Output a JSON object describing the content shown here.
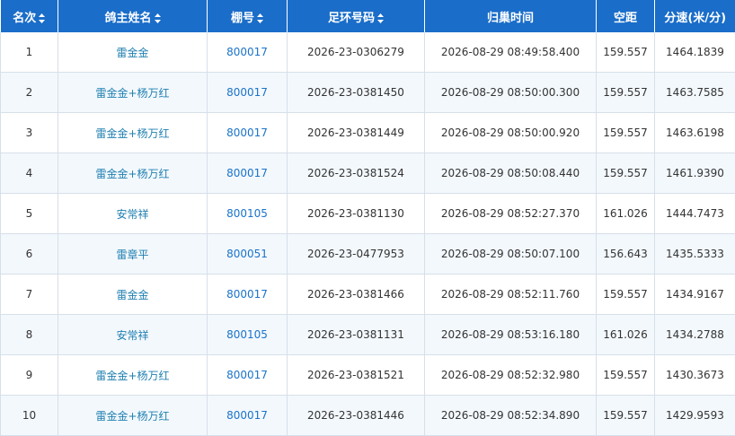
{
  "table": {
    "headers": [
      {
        "key": "rank",
        "label": "名次",
        "sortable": true
      },
      {
        "key": "owner",
        "label": "鸽主姓名",
        "sortable": true
      },
      {
        "key": "loft",
        "label": "棚号",
        "sortable": true
      },
      {
        "key": "ring",
        "label": "足环号码",
        "sortable": true
      },
      {
        "key": "arrival",
        "label": "归巢时间",
        "sortable": false
      },
      {
        "key": "distance",
        "label": "空距",
        "sortable": false
      },
      {
        "key": "speed",
        "label": "分速(米/分)",
        "sortable": false
      }
    ],
    "rows": [
      {
        "rank": "1",
        "owner": "雷金金",
        "loft": "800017",
        "ring": "2026-23-0306279",
        "arrival": "2026-08-29 08:49:58.400",
        "distance": "159.557",
        "speed": "1464.1839"
      },
      {
        "rank": "2",
        "owner": "雷金金+杨万红",
        "loft": "800017",
        "ring": "2026-23-0381450",
        "arrival": "2026-08-29 08:50:00.300",
        "distance": "159.557",
        "speed": "1463.7585"
      },
      {
        "rank": "3",
        "owner": "雷金金+杨万红",
        "loft": "800017",
        "ring": "2026-23-0381449",
        "arrival": "2026-08-29 08:50:00.920",
        "distance": "159.557",
        "speed": "1463.6198"
      },
      {
        "rank": "4",
        "owner": "雷金金+杨万红",
        "loft": "800017",
        "ring": "2026-23-0381524",
        "arrival": "2026-08-29 08:50:08.440",
        "distance": "159.557",
        "speed": "1461.9390"
      },
      {
        "rank": "5",
        "owner": "安常祥",
        "loft": "800105",
        "ring": "2026-23-0381130",
        "arrival": "2026-08-29 08:52:27.370",
        "distance": "161.026",
        "speed": "1444.7473"
      },
      {
        "rank": "6",
        "owner": "雷章平",
        "loft": "800051",
        "ring": "2026-23-0477953",
        "arrival": "2026-08-29 08:50:07.100",
        "distance": "156.643",
        "speed": "1435.5333"
      },
      {
        "rank": "7",
        "owner": "雷金金",
        "loft": "800017",
        "ring": "2026-23-0381466",
        "arrival": "2026-08-29 08:52:11.760",
        "distance": "159.557",
        "speed": "1434.9167"
      },
      {
        "rank": "8",
        "owner": "安常祥",
        "loft": "800105",
        "ring": "2026-23-0381131",
        "arrival": "2026-08-29 08:53:16.180",
        "distance": "161.026",
        "speed": "1434.2788"
      },
      {
        "rank": "9",
        "owner": "雷金金+杨万红",
        "loft": "800017",
        "ring": "2026-23-0381521",
        "arrival": "2026-08-29 08:52:32.980",
        "distance": "159.557",
        "speed": "1430.3673"
      },
      {
        "rank": "10",
        "owner": "雷金金+杨万红",
        "loft": "800017",
        "ring": "2026-23-0381446",
        "arrival": "2026-08-29 08:52:34.890",
        "distance": "159.557",
        "speed": "1429.9593"
      }
    ]
  },
  "colors": {
    "header_bg": "#1a6dc9",
    "header_text": "#ffffff",
    "owner_link": "#1f7fb0",
    "loft_link": "#1a73c9",
    "row_alt_bg": "#f3f8fd",
    "border": "#d7dfe8"
  },
  "icons": {
    "sort": "sort-icon"
  }
}
